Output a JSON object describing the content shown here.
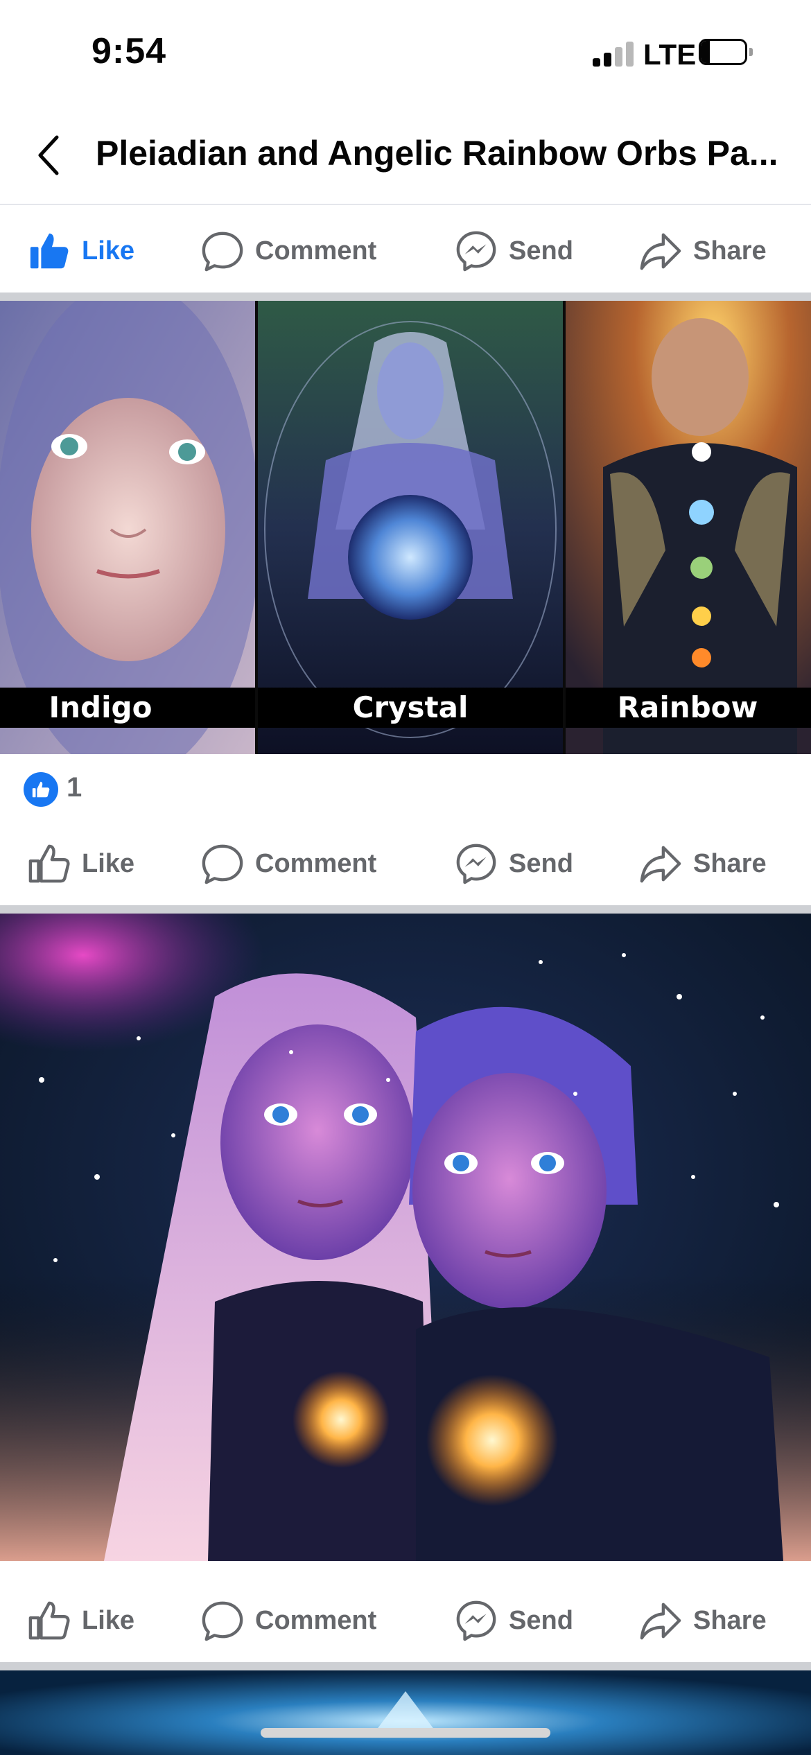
{
  "status_bar": {
    "time": "9:54",
    "network": "LTE",
    "battery": "21",
    "battery_level": 0.21
  },
  "header": {
    "title": "Pleiadian and Angelic Rainbow Orbs Pa..."
  },
  "actions": {
    "like": "Like",
    "comment": "Comment",
    "send": "Send",
    "share": "Share"
  },
  "post1": {
    "image": {
      "panels": [
        "Indigo",
        "Crystal",
        "Rainbow"
      ]
    },
    "reaction_count": "1",
    "liked": true
  },
  "post2": {
    "liked": false
  },
  "colors": {
    "accent": "#1877f2",
    "muted": "#65676b",
    "divider": "#ced0d4"
  },
  "icons": [
    "back-chevron-icon",
    "thumbs-up-icon",
    "comment-bubble-icon",
    "messenger-icon",
    "share-arrow-icon"
  ]
}
